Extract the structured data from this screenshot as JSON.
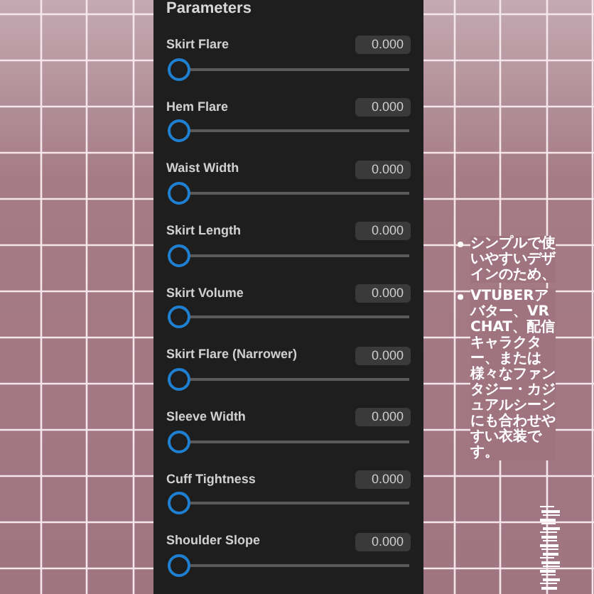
{
  "panel": {
    "title": "Parameters",
    "parameters": [
      {
        "label": "Skirt Flare",
        "value": "0.000",
        "level": 0
      },
      {
        "label": "Hem Flare",
        "value": "0.000",
        "level": 0
      },
      {
        "label": "Waist Width",
        "value": "0.000",
        "level": 0
      },
      {
        "label": "Skirt Length",
        "value": "0.000",
        "level": 0
      },
      {
        "label": "Skirt Volume",
        "value": "0.000",
        "level": 0
      },
      {
        "label": "Skirt Flare (Narrower)",
        "value": "0.000",
        "level": 0
      },
      {
        "label": "Sleeve Width",
        "value": "0.000",
        "level": 0
      },
      {
        "label": "Cuff Tightness",
        "value": "0.000",
        "level": 0
      },
      {
        "label": "Shoulder Slope",
        "value": "0.000",
        "level": 0
      }
    ]
  },
  "description": {
    "bullets": [
      "シンプルで使いやすいデザインのため、",
      "VTUBERアバター、VRCHAT、配信キャラクター、または様々なファンタジー・カジュアルシーンにも合わせやすい衣装です。"
    ]
  }
}
